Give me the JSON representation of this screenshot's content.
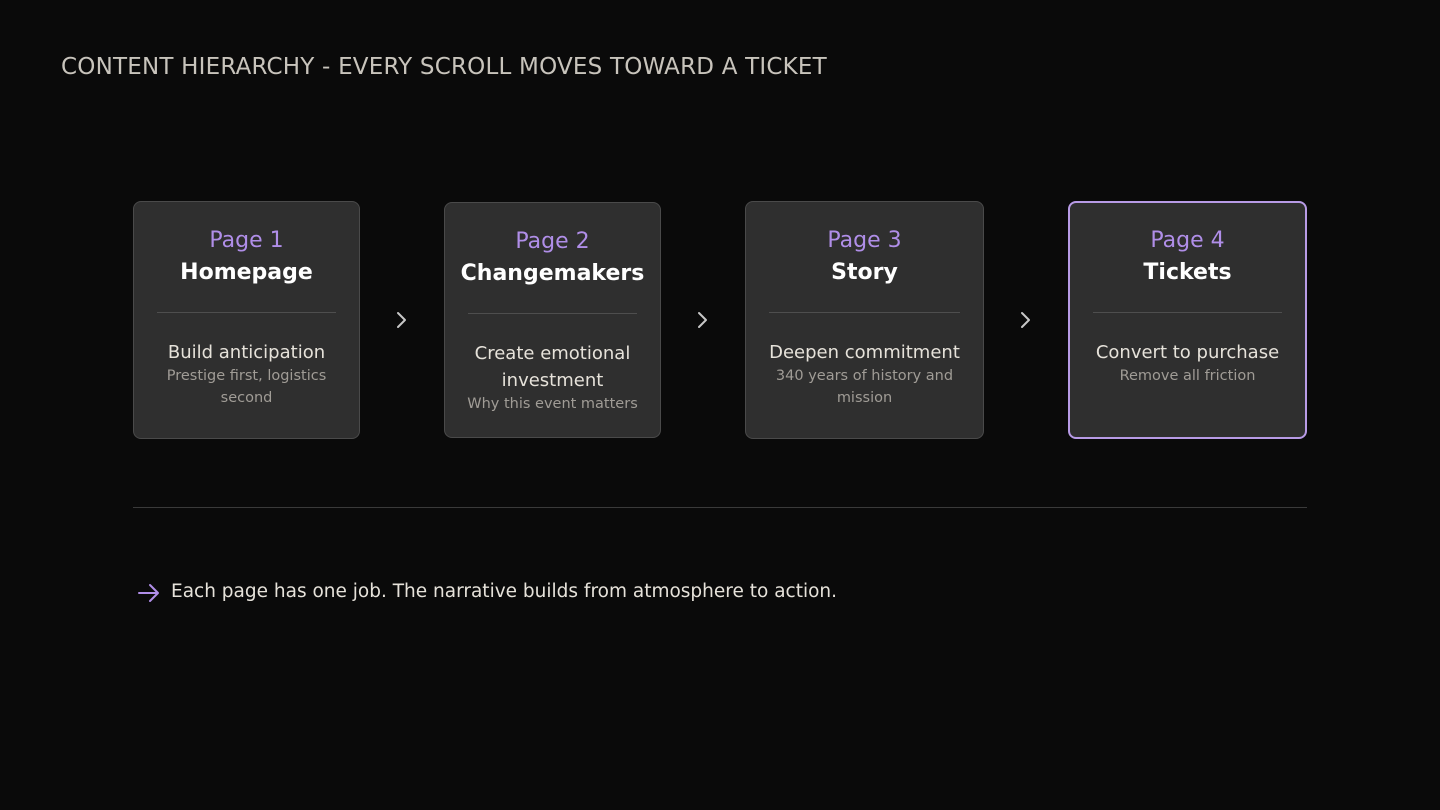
{
  "title": "CONTENT HIERARCHY - EVERY SCROLL MOVES TOWARD A TICKET",
  "accent_color": "#b08ee8",
  "pages": [
    {
      "number": "Page 1",
      "name": "Homepage",
      "goal": "Build anticipation",
      "detail": "Prestige first, logistics second"
    },
    {
      "number": "Page 2",
      "name": "Changemakers",
      "goal": "Create emotional investment",
      "detail": "Why this event matters"
    },
    {
      "number": "Page 3",
      "name": "Story",
      "goal": "Deepen commitment",
      "detail": "340 years of history and mission"
    },
    {
      "number": "Page 4",
      "name": "Tickets",
      "goal": "Convert to purchase",
      "detail": "Remove all friction",
      "highlighted": true
    }
  ],
  "connector_icon": "chevron-right-icon",
  "footnote": {
    "icon": "arrow-right-icon",
    "text": "Each page has one job. The narrative builds from atmosphere to action."
  }
}
